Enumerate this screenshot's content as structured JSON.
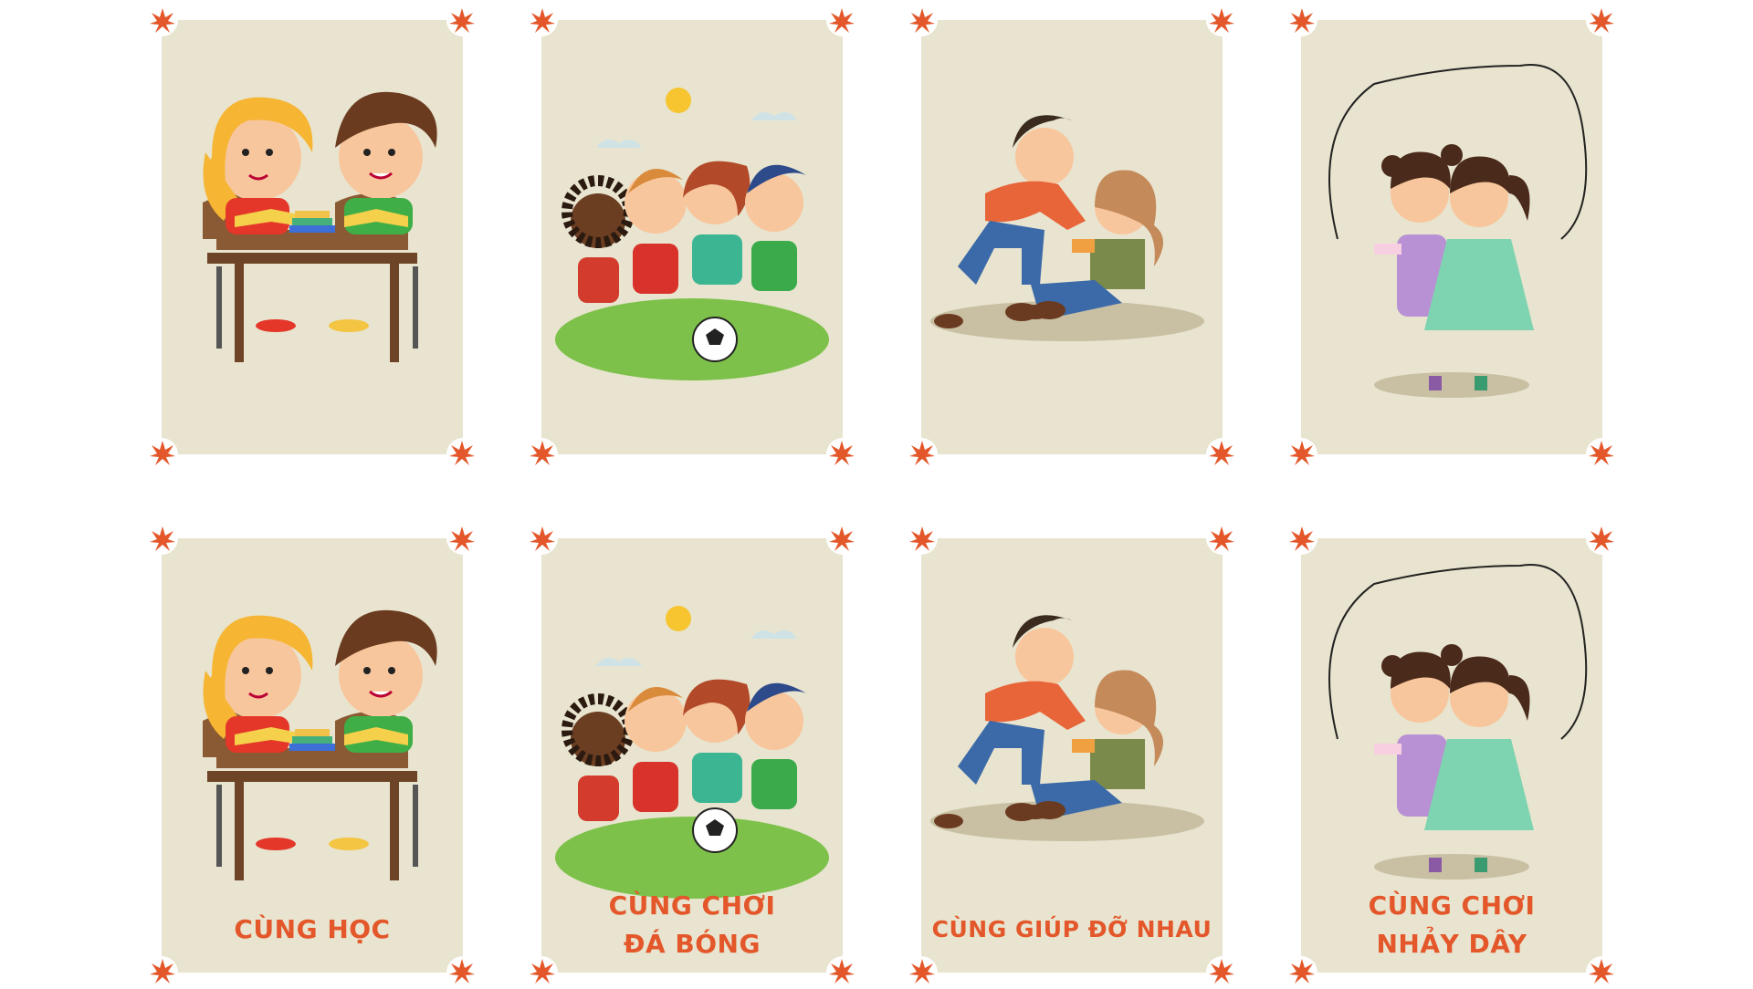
{
  "colors": {
    "card_background": "#e8e4cf",
    "caption": "#e3572a",
    "corner_burst": "#e3572a"
  },
  "cards": [
    {
      "scene": "studying-together",
      "caption_lines": []
    },
    {
      "scene": "playing-football",
      "caption_lines": []
    },
    {
      "scene": "helping-each-other",
      "caption_lines": []
    },
    {
      "scene": "jumping-rope",
      "caption_lines": []
    },
    {
      "scene": "studying-together",
      "caption_lines": [
        "CÙNG HỌC"
      ]
    },
    {
      "scene": "playing-football",
      "caption_lines": [
        "CÙNG CHƠI",
        "ĐÁ BÓNG"
      ]
    },
    {
      "scene": "helping-each-other",
      "caption_lines": [
        "CÙNG GIÚP ĐỠ NHAU"
      ]
    },
    {
      "scene": "jumping-rope",
      "caption_lines": [
        "CÙNG CHƠI",
        "NHẢY DÂY"
      ]
    }
  ]
}
